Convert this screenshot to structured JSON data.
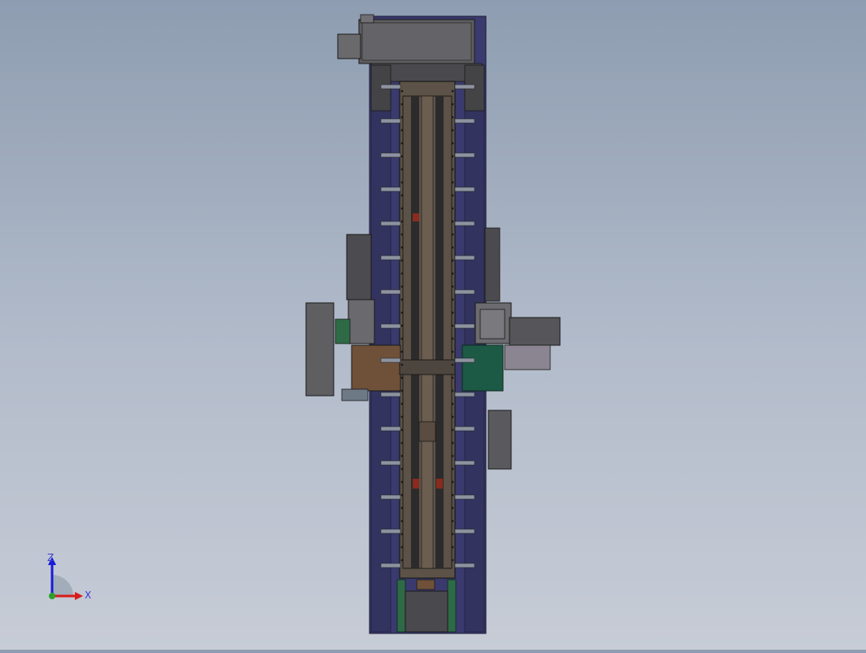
{
  "viewport": {
    "colors": {
      "background_top": "#8e9db1",
      "background_bottom": "#c7ccd6",
      "frame_blue": "#39396e",
      "beam_brown": "#5e5348",
      "rail_dark": "#2c2b2b",
      "housing_gray": "#5f5f62",
      "carriage_copper": "#6e5138",
      "carriage_green": "#1d5a45",
      "accent_red": "#8a2b1f"
    }
  },
  "triad": {
    "z_label": "Z",
    "x_label": "X",
    "z_color": "#1b1bd8",
    "x_color": "#d81b1b",
    "origin_color": "#2aa02a"
  }
}
